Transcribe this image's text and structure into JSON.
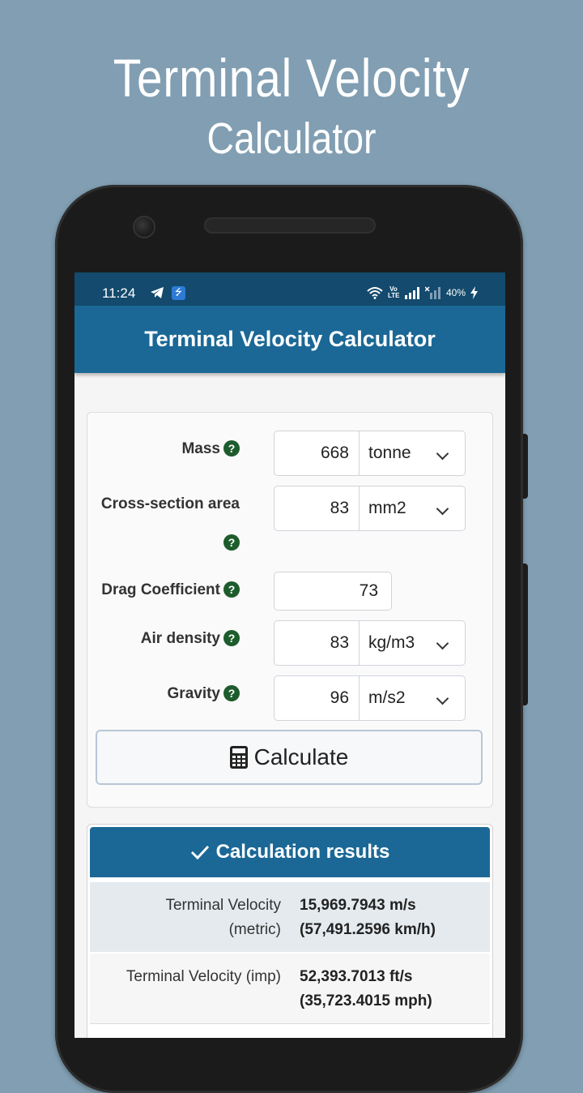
{
  "promo": {
    "line1": "Terminal Velocity",
    "line2": "Calculator"
  },
  "status_bar": {
    "time": "11:24",
    "battery": "40%",
    "network_label": "Vo LTE"
  },
  "app_bar": {
    "title": "Terminal Velocity Calculator"
  },
  "form": {
    "fields": [
      {
        "label": "Mass",
        "value": "668",
        "unit": "tonne"
      },
      {
        "label": "Cross-section area",
        "value": "83",
        "unit": "mm2"
      },
      {
        "label": "Drag Coefficient",
        "value": "73"
      },
      {
        "label": "Air density",
        "value": "83",
        "unit": "kg/m3"
      },
      {
        "label": "Gravity",
        "value": "96",
        "unit": "m/s2"
      }
    ],
    "help_symbol": "?",
    "calculate_label": "Calculate"
  },
  "results": {
    "header": "Calculation results",
    "rows": [
      {
        "label_line1": "Terminal Velocity",
        "label_line2": "(metric)",
        "value_line1": "15,969.7943 m/s",
        "value_line2": "(57,491.2596 km/h)"
      },
      {
        "label_line1": "Terminal Velocity (imp)",
        "label_line2": "",
        "value_line1": "52,393.7013 ft/s",
        "value_line2": "(35,723.4015 mph)"
      }
    ]
  },
  "colors": {
    "background": "#819eb2",
    "status_bar": "#134a6d",
    "app_bar": "#1b6896",
    "help_icon": "#1d5c2c"
  }
}
